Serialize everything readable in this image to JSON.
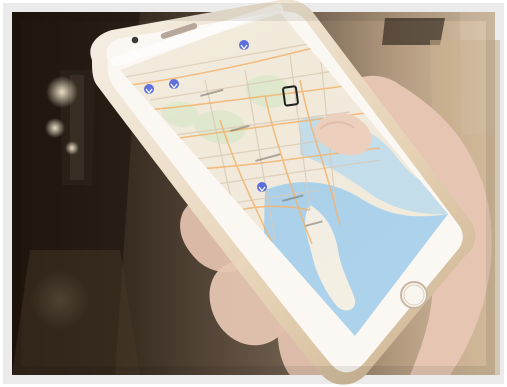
{
  "scene": {
    "description_free": true,
    "phone": {
      "status_bar": {
        "carrier": "",
        "time": "",
        "battery": ""
      },
      "map": {
        "visible_labels": []
      }
    }
  },
  "colors": {
    "frame_white": "#ffffff",
    "hallway_dark": "#3a2f24",
    "wall_warm": "#b79f82",
    "phone_gold": "#e7d6b8",
    "phone_body": "#f3eee6",
    "map_land": "#f1eadb",
    "map_water": "#a9d0ea",
    "map_roads": "#f1b36e",
    "map_border": "#d9c9b3",
    "hand_skin": "#e8c9b6"
  }
}
